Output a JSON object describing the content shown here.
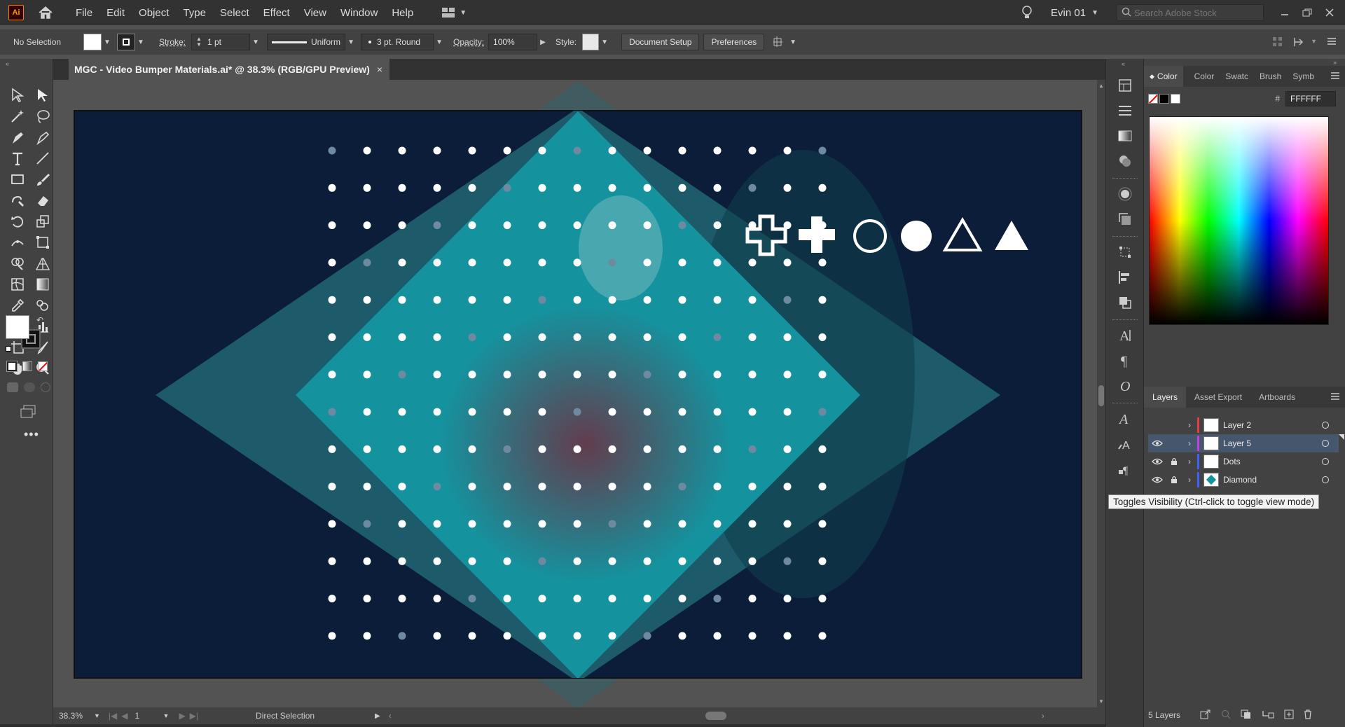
{
  "app": {
    "logo_text": "Ai",
    "menu": [
      "File",
      "Edit",
      "Object",
      "Type",
      "Select",
      "Effect",
      "View",
      "Window",
      "Help"
    ],
    "user_name": "Evin 01",
    "stock_search_placeholder": "Search Adobe Stock"
  },
  "control_bar": {
    "selection_label": "No Selection",
    "stroke_label": "Stroke:",
    "stroke_weight": "1 pt",
    "stroke_profile": "Uniform",
    "brush_label": "3 pt. Round",
    "opacity_label": "Opacity:",
    "opacity_value": "100%",
    "style_label": "Style:",
    "document_setup": "Document Setup",
    "preferences": "Preferences"
  },
  "document": {
    "tab_title": "MGC - Video Bumper Materials.ai* @ 38.3% (RGB/GPU Preview)",
    "close_glyph": "×",
    "zoom": "38.3%",
    "artboard_number": "1",
    "status_tool": "Direct Selection"
  },
  "colors": {
    "artboard_bg": "#0b1d38",
    "diamond_outer": "#1d5a6a",
    "diamond_inner": "#14939f",
    "accent_select": "#46566d",
    "fill_swatch": "#ffffff",
    "stroke_swatch": "#000000"
  },
  "color_panel": {
    "tabs": [
      "Color",
      "Color",
      "Swatc",
      "Brush",
      "Symb"
    ],
    "hash": "#",
    "hex_value": "FFFFFF"
  },
  "layers_panel": {
    "tabs": [
      "Layers",
      "Asset Export",
      "Artboards"
    ],
    "layers": [
      {
        "name": "Layer 2",
        "visible": false,
        "locked": false,
        "color": "#e04040",
        "selected": false
      },
      {
        "name": "Layer 5",
        "visible": true,
        "locked": false,
        "color": "#c040e0",
        "selected": true
      },
      {
        "name": "Dots",
        "visible": true,
        "locked": true,
        "color": "#4060ff",
        "selected": false
      },
      {
        "name": "Diamond",
        "visible": true,
        "locked": true,
        "color": "#4060ff",
        "selected": false
      }
    ],
    "count_label": "5 Layers",
    "tooltip": "Toggles Visibility (Ctrl-click to toggle view mode)"
  },
  "artwork_icons": [
    "plus-outline-icon",
    "plus-solid-icon",
    "circle-outline-icon",
    "circle-solid-icon",
    "triangle-outline-icon",
    "triangle-solid-icon"
  ]
}
